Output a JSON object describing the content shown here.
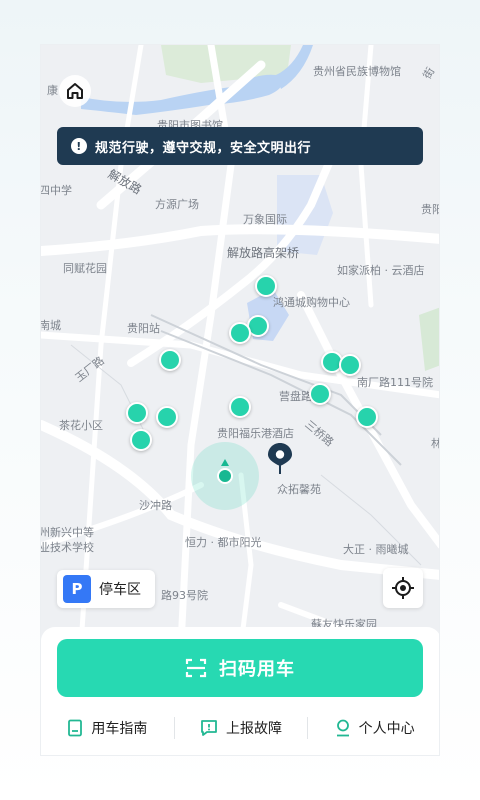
{
  "notice": {
    "text": "规范行驶，遵守交规，安全文明出行",
    "icon": "exclamation-icon"
  },
  "map": {
    "labels": [
      {
        "id": "l1",
        "text": "贵州省民族博物馆"
      },
      {
        "id": "l2",
        "text": "贵阳市图书馆"
      },
      {
        "id": "l3",
        "text": "四中学"
      },
      {
        "id": "l4",
        "text": "解放路"
      },
      {
        "id": "l5",
        "text": "方源广场"
      },
      {
        "id": "l6",
        "text": "万象国际"
      },
      {
        "id": "l7",
        "text": "贵阳"
      },
      {
        "id": "l8",
        "text": "解放路高架桥"
      },
      {
        "id": "l9",
        "text": "同赋花园"
      },
      {
        "id": "l10",
        "text": "如家派柏 · 云酒店"
      },
      {
        "id": "l11",
        "text": "鸿通城购物中心"
      },
      {
        "id": "l12",
        "text": "南城"
      },
      {
        "id": "l13",
        "text": "贵阳站"
      },
      {
        "id": "l14",
        "text": "玉厂路"
      },
      {
        "id": "l15",
        "text": "南厂路111号院"
      },
      {
        "id": "l16",
        "text": "营盘路"
      },
      {
        "id": "l17",
        "text": "茶花小区"
      },
      {
        "id": "l18",
        "text": "贵阳福乐港酒店"
      },
      {
        "id": "l19",
        "text": "三桥路"
      },
      {
        "id": "l20",
        "text": "林"
      },
      {
        "id": "l21",
        "text": "众拓馨苑"
      },
      {
        "id": "l22",
        "text": "沙冲路"
      },
      {
        "id": "l23",
        "text": "州新兴中等"
      },
      {
        "id": "l24",
        "text": "业技术学校"
      },
      {
        "id": "l25",
        "text": "恒力 · 都市阳光"
      },
      {
        "id": "l26",
        "text": "大正 · 雨曦城"
      },
      {
        "id": "l27",
        "text": "路93号院"
      },
      {
        "id": "l28",
        "text": "蘇友快乐家园"
      },
      {
        "id": "l29",
        "text": "康"
      },
      {
        "id": "l30",
        "text": "贵"
      },
      {
        "id": "l31",
        "text": "街"
      }
    ],
    "bike_count": 14
  },
  "buttons": {
    "home_icon": "home-icon",
    "parking": {
      "badge": "P",
      "label": "停车区"
    },
    "locate_icon": "locate-icon",
    "scan": {
      "label": "扫码用车",
      "icon": "scan-icon"
    }
  },
  "bottom_links": [
    {
      "label": "用车指南",
      "icon": "guide-book-icon"
    },
    {
      "label": "上报故障",
      "icon": "report-icon"
    },
    {
      "label": "个人中心",
      "icon": "user-icon"
    }
  ],
  "colors": {
    "accent": "#27d9b2",
    "notice_bg": "#1f3a52",
    "parking_blue": "#3478f6",
    "pin": "#1f3a52"
  }
}
